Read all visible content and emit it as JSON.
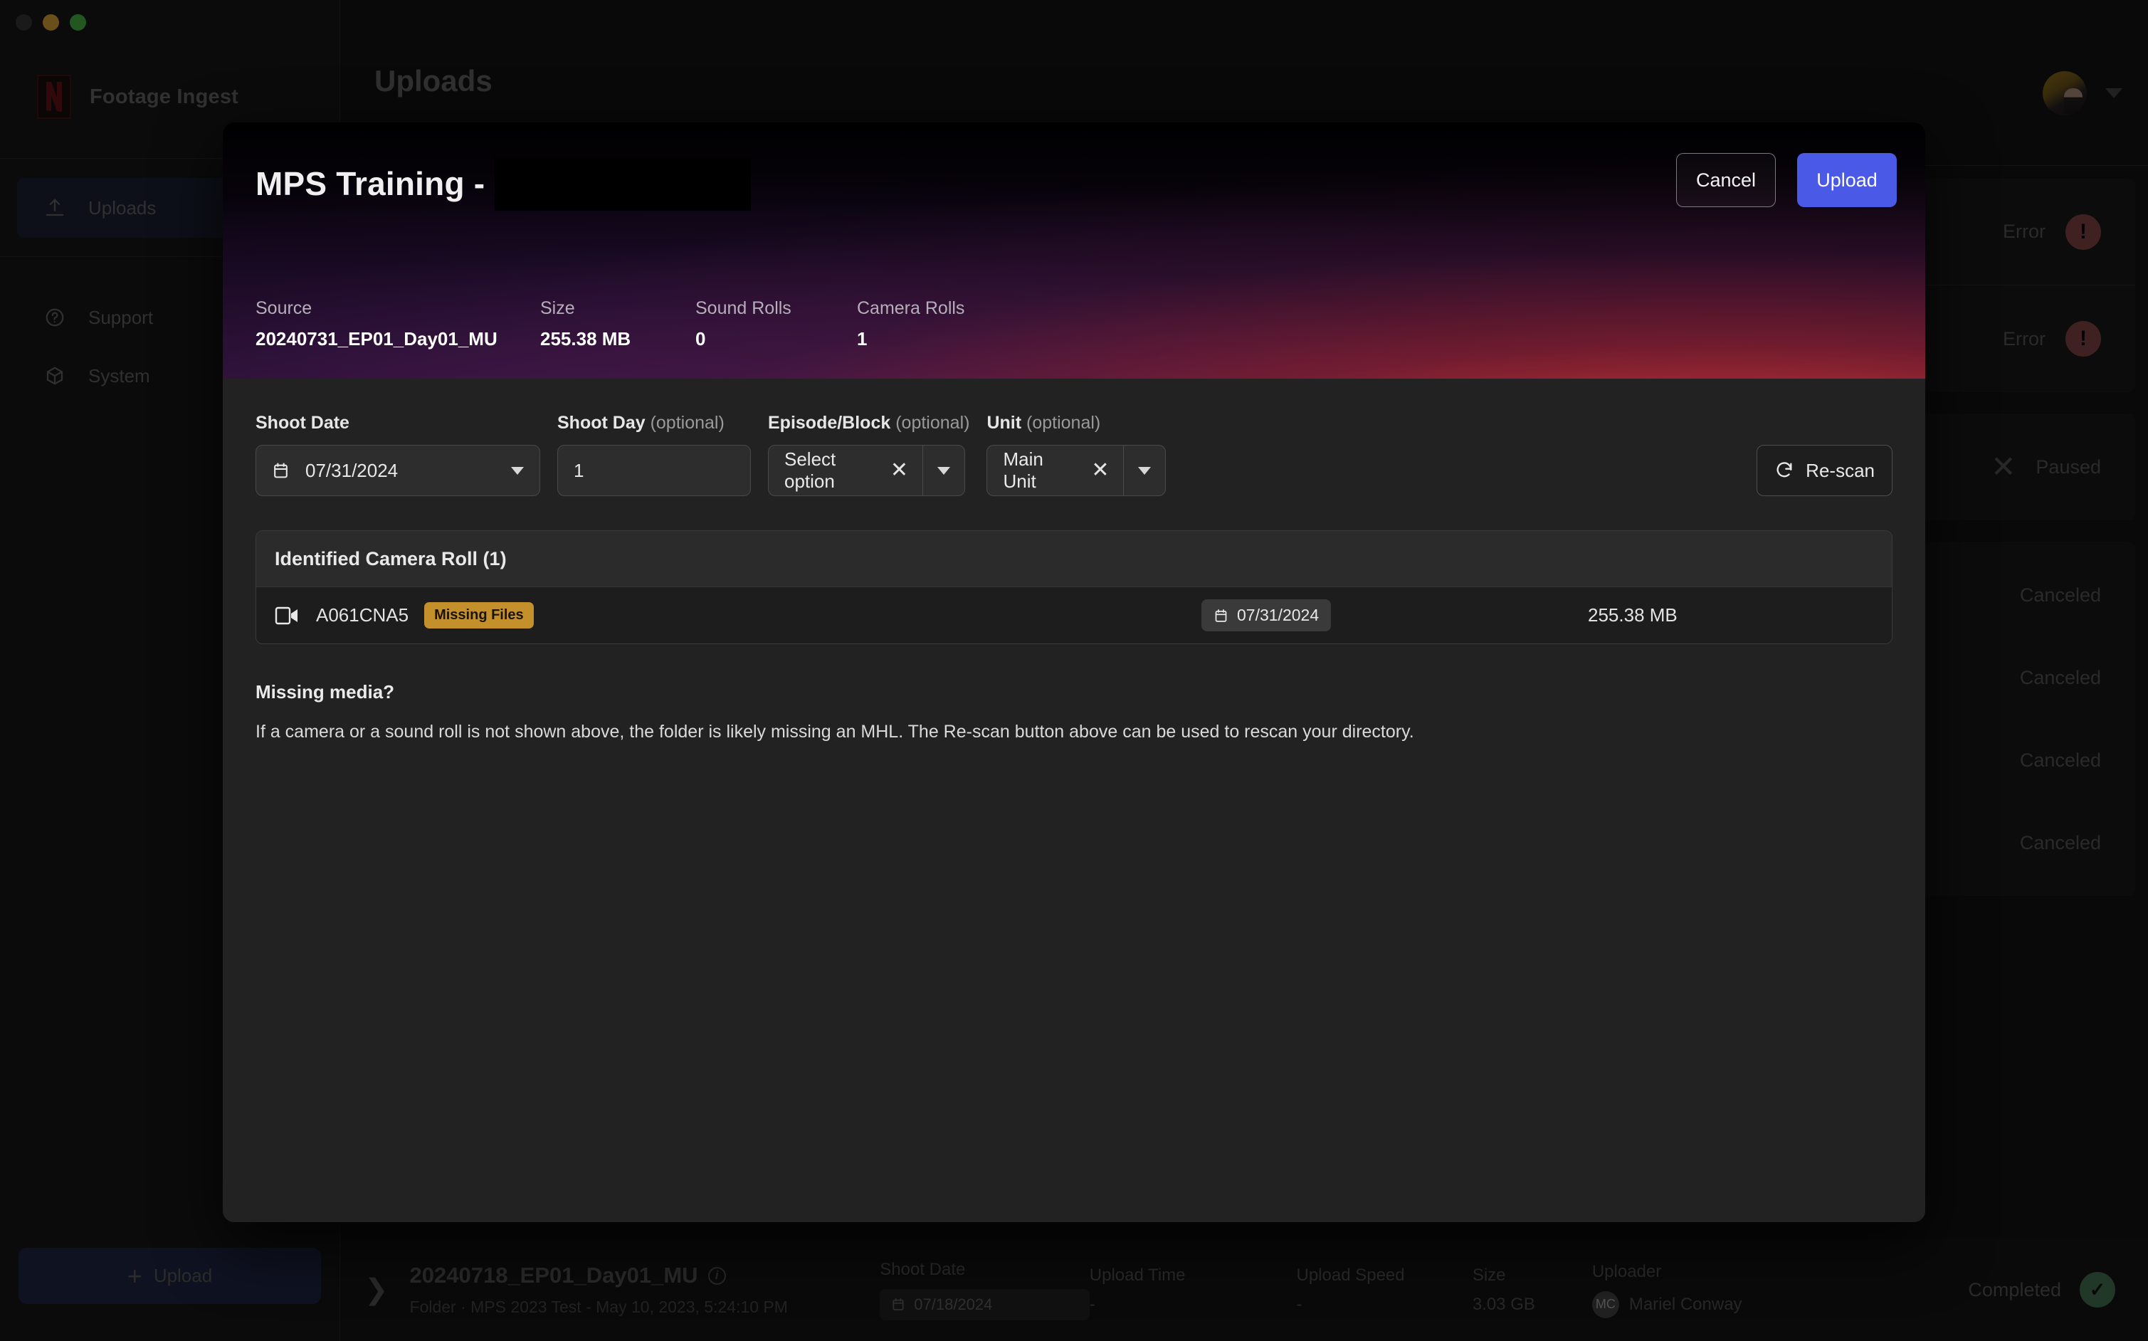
{
  "window": {
    "traffic_lights": [
      "close",
      "minimize",
      "zoom"
    ]
  },
  "sidebar": {
    "brand": "Footage Ingest",
    "brand_logo_icon": "netflix-n-logo",
    "items": [
      {
        "label": "Uploads",
        "icon": "upload-icon",
        "active": true
      },
      {
        "label": "Support",
        "icon": "help-circle-icon",
        "active": false
      },
      {
        "label": "System",
        "icon": "box-icon",
        "active": false
      }
    ],
    "upload_button": {
      "label": "Upload",
      "icon": "plus-icon"
    }
  },
  "header": {
    "page_title": "Uploads",
    "avatar_icon": "user-avatar",
    "caret_icon": "chevron-down-icon"
  },
  "background_rows": [
    {
      "status": "Error",
      "icon": "alert-circle-icon"
    },
    {
      "status": "Error",
      "icon": "alert-circle-icon"
    },
    {
      "status": "Paused",
      "icon": "close-x-icon"
    },
    {
      "status": "Canceled",
      "icon": ""
    },
    {
      "status": "Canceled",
      "icon": ""
    },
    {
      "status": "Canceled",
      "icon": ""
    },
    {
      "status": "Canceled",
      "icon": ""
    }
  ],
  "bottom_row": {
    "expand_icon": "chevron-right-icon",
    "name": "20240718_EP01_Day01_MU",
    "info_icon": "info-icon",
    "subtitle": "Folder · MPS 2023 Test - May 10, 2023, 5:24:10 PM",
    "columns": [
      {
        "header": "Shoot Date",
        "value": "07/18/2024",
        "type": "date-chip",
        "icon": "calendar-icon"
      },
      {
        "header": "Upload Time",
        "value": "-",
        "type": "text"
      },
      {
        "header": "Upload Speed",
        "value": "-",
        "type": "text"
      },
      {
        "header": "Size",
        "value": "3.03 GB",
        "type": "text"
      },
      {
        "header": "Uploader",
        "value": "Mariel Conway",
        "type": "user",
        "initials": "MC"
      }
    ],
    "status": "Completed",
    "status_icon": "check-circle-icon"
  },
  "modal": {
    "title": "MPS Training -",
    "title_redacted": true,
    "cancel_label": "Cancel",
    "upload_label": "Upload",
    "meta": [
      {
        "label": "Source",
        "value": "20240731_EP01_Day01_MU"
      },
      {
        "label": "Size",
        "value": "255.38 MB"
      },
      {
        "label": "Sound Rolls",
        "value": "0"
      },
      {
        "label": "Camera Rolls",
        "value": "1"
      }
    ],
    "fields": {
      "shoot_date": {
        "label": "Shoot Date",
        "optional": "",
        "value": "07/31/2024",
        "icon": "calendar-icon",
        "caret_icon": "chevron-down-icon"
      },
      "shoot_day": {
        "label": "Shoot Day",
        "optional": "(optional)",
        "value": "1",
        "placeholder": ""
      },
      "episode_block": {
        "label": "Episode/Block",
        "optional": "(optional)",
        "value": "Select option",
        "clear_icon": "close-x-icon",
        "caret_icon": "chevron-down-icon"
      },
      "unit": {
        "label": "Unit",
        "optional": "(optional)",
        "value": "Main Unit",
        "clear_icon": "close-x-icon",
        "caret_icon": "chevron-down-icon"
      }
    },
    "rescan": {
      "label": "Re-scan",
      "icon": "refresh-icon"
    },
    "rolls": {
      "header": "Identified Camera Roll (1)",
      "rows": [
        {
          "icon": "video-camera-icon",
          "name": "A061CNA5",
          "badge": "Missing Files",
          "date": "07/31/2024",
          "date_icon": "calendar-icon",
          "size": "255.38 MB"
        }
      ]
    },
    "missing_media": {
      "heading": "Missing media?",
      "body": "If a camera or a sound roll is not shown above, the folder is likely missing an MHL. The Re-scan button above can be used to rescan your directory."
    }
  },
  "colors": {
    "accent_blue": "#4b5ae6",
    "warning_amber": "#c3902c",
    "error_red": "#8c4a4a",
    "success_green": "#4a7a58",
    "sidebar_bg": "#1a1a1a",
    "modal_bg": "#222222"
  }
}
